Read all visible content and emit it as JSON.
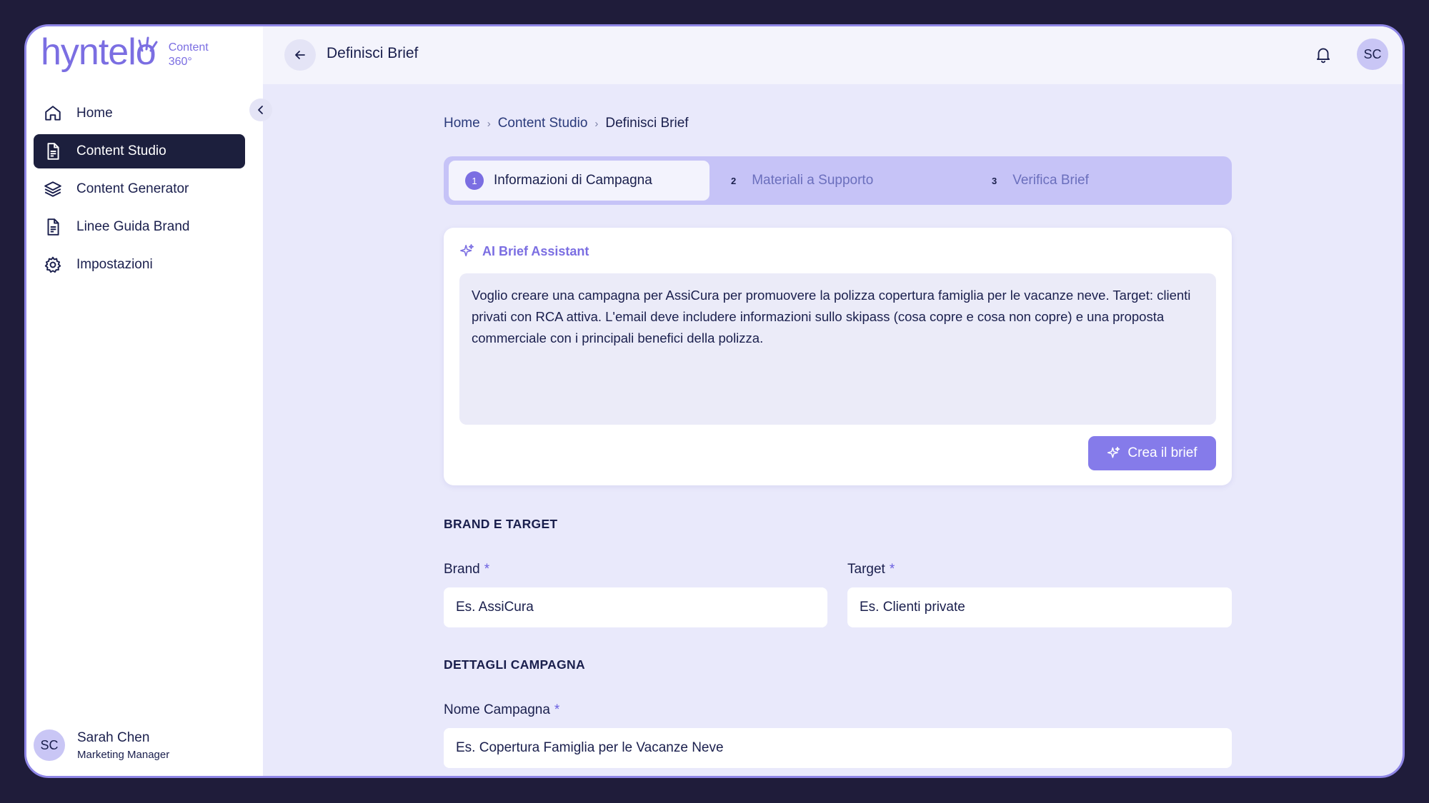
{
  "app": {
    "logo_text": "hyntelo",
    "logo_sub_line1": "Content",
    "logo_sub_line2": "360°"
  },
  "sidebar": {
    "items": [
      {
        "label": "Home",
        "icon": "home-icon"
      },
      {
        "label": "Content Studio",
        "icon": "document-icon",
        "active": true
      },
      {
        "label": "Content Generator",
        "icon": "layers-icon"
      },
      {
        "label": "Linee Guida Brand",
        "icon": "document-icon"
      },
      {
        "label": "Impostazioni",
        "icon": "gear-icon"
      }
    ],
    "user": {
      "initials": "SC",
      "name": "Sarah Chen",
      "role": "Marketing Manager"
    }
  },
  "header": {
    "title": "Definisci Brief",
    "avatar_initials": "SC"
  },
  "breadcrumb": [
    "Home",
    "Content Studio",
    "Definisci Brief"
  ],
  "stepper": [
    {
      "num": "1",
      "label": "Informazioni di Campagna",
      "active": true
    },
    {
      "num": "2",
      "label": "Materiali a Supporto"
    },
    {
      "num": "3",
      "label": "Verifica Brief"
    }
  ],
  "assistant": {
    "title": "AI Brief Assistant",
    "text": "Voglio creare una campagna per AssiCura per promuovere la polizza copertura famiglia per le vacanze neve. Target: clienti privati con RCA attiva. L'email deve includere informazioni sullo skipass (cosa copre e cosa non copre) e una proposta commerciale con i principali benefici della polizza.",
    "button_label": "Crea il brief"
  },
  "brand_target": {
    "section_title": "BRAND E TARGET",
    "brand_label": "Brand",
    "brand_placeholder": "Es. AssiCura",
    "target_label": "Target",
    "target_placeholder": "Es. Clienti private",
    "required_mark": "*"
  },
  "campaign": {
    "section_title": "DETTAGLI CAMPAGNA",
    "name_label": "Nome Campagna",
    "name_placeholder": "Es. Copertura Famiglia per le Vacanze Neve"
  },
  "colors": {
    "accent": "#7b6ee2",
    "sidebar_active": "#1c1f3d",
    "background": "#e9e9fb",
    "stepper_bg": "#c6c3f7"
  }
}
